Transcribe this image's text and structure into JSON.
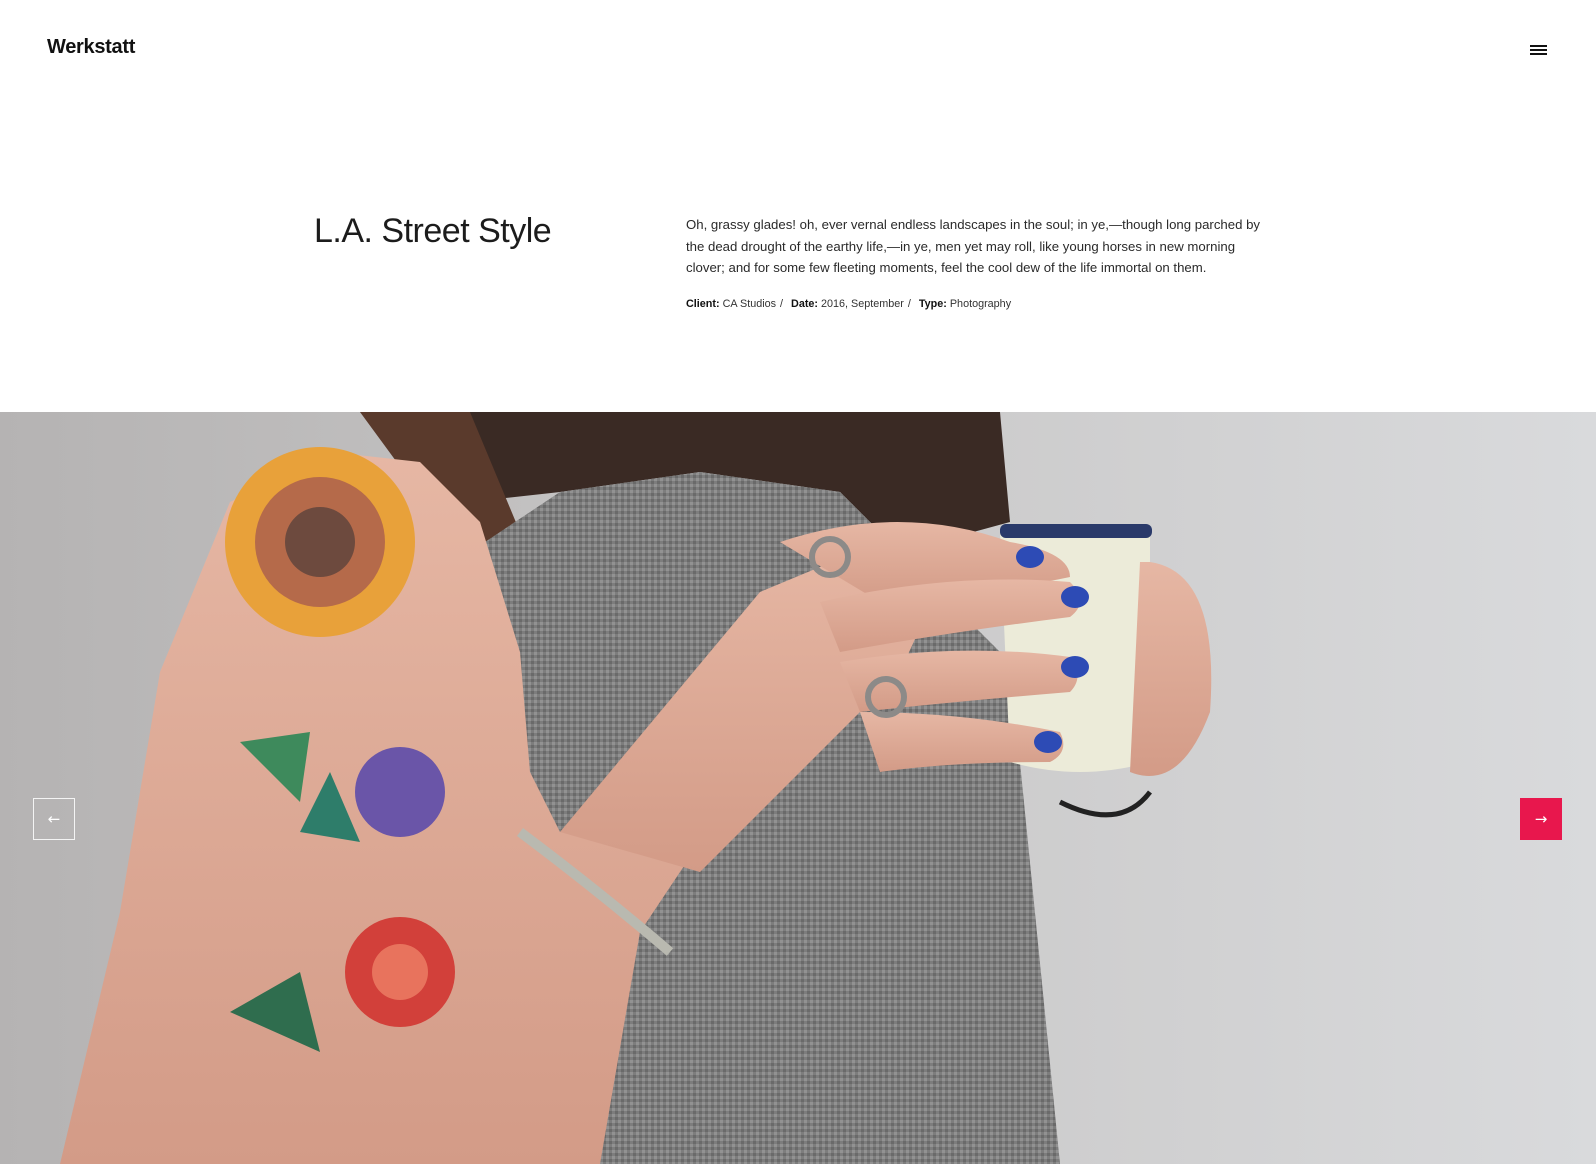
{
  "header": {
    "logo": "Werkstatt",
    "menu_icon": "hamburger-menu-icon"
  },
  "project": {
    "title": "L.A. Street Style",
    "description": "Oh, grassy glades! oh, ever vernal endless landscapes in the soul; in ye,—though long parched by the dead drought of the earthy life,—in ye, men yet may roll, like young horses in new morning clover; and for some few fleeting moments, feel the cool dew of the life immortal on them.",
    "meta": {
      "client_label": "Client:",
      "client_value": "CA Studios",
      "date_label": "Date:",
      "date_value": "2016, September",
      "type_label": "Type:",
      "type_value": "Photography",
      "separator": "/"
    }
  },
  "gallery": {
    "prev_icon": "arrow-left-icon",
    "next_icon": "arrow-right-icon",
    "prev_glyph": "←",
    "next_glyph": "→",
    "accent_color": "#e8174d"
  }
}
